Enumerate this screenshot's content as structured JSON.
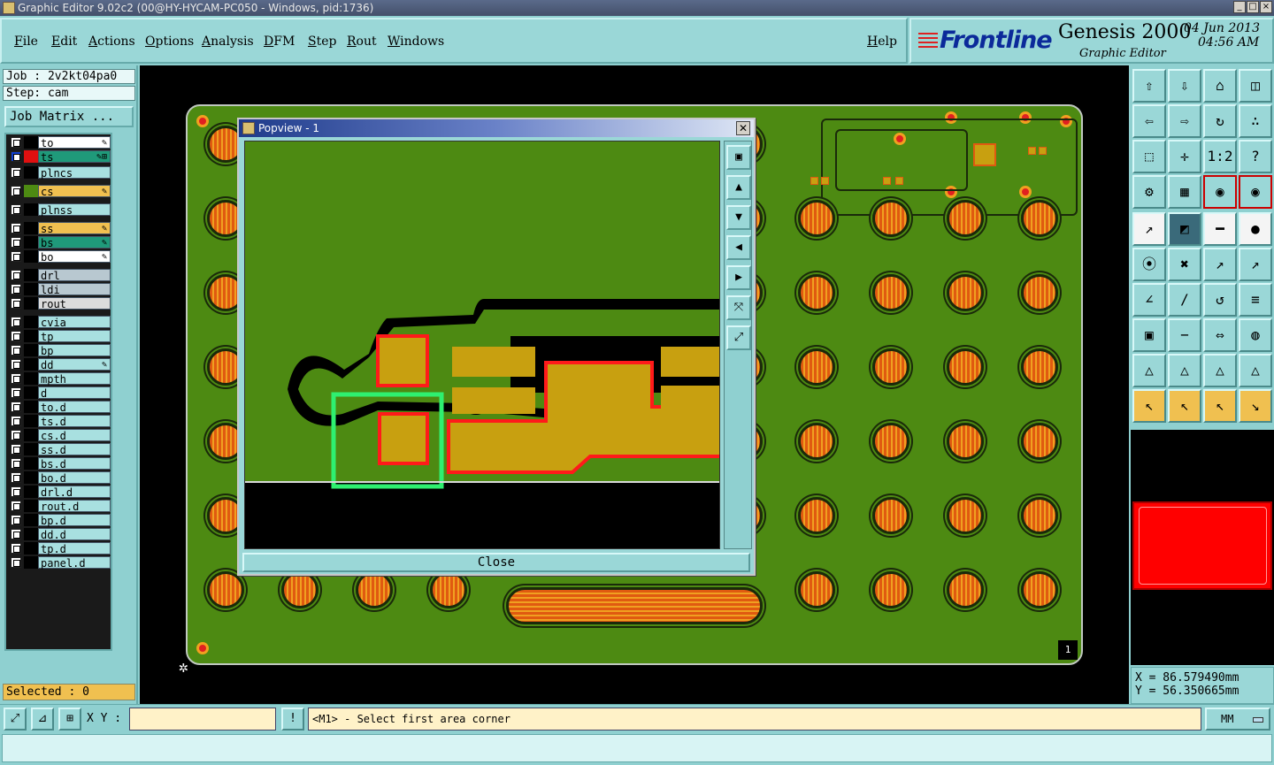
{
  "window": {
    "title": "Graphic Editor 9.02c2 (00@HY-HYCAM-PC050 - Windows, pid:1736)"
  },
  "menu": [
    "File",
    "Edit",
    "Actions",
    "Options",
    "Analysis",
    "DFM",
    "Step",
    "Rout",
    "Windows"
  ],
  "help_label": "Help",
  "logo": {
    "brand": "Frontline",
    "product": "Genesis 2000",
    "subtitle": "Graphic Editor",
    "date": "04 Jun 2013",
    "time": "04:56 AM"
  },
  "job": {
    "job_label": "Job : 2v2kt04pa0",
    "step_label": "Step: cam",
    "matrix_button": "Job Matrix ..."
  },
  "layers": [
    {
      "name": "to",
      "color": "#ffffff",
      "swatch": "#000000",
      "flag": "✎"
    },
    {
      "name": "ts",
      "color": "#1f9a7a",
      "swatch": "#e01010",
      "flag": "✎⊞",
      "active": true
    },
    {
      "name": "plncs",
      "color": "#a8e0e0",
      "swatch": "#000000",
      "flag": ""
    },
    {
      "name": "cs",
      "color": "#f0c050",
      "swatch": "#4d8a12",
      "flag": "✎"
    },
    {
      "name": "plnss",
      "color": "#a8e0e0",
      "swatch": "#000000",
      "flag": ""
    },
    {
      "name": "ss",
      "color": "#f0c050",
      "swatch": "#000000",
      "flag": "✎"
    },
    {
      "name": "bs",
      "color": "#1f9a7a",
      "swatch": "#000000",
      "flag": "✎"
    },
    {
      "name": "bo",
      "color": "#ffffff",
      "swatch": "#000000",
      "flag": "✎"
    },
    {
      "name": "drl",
      "color": "#b8c8d0",
      "swatch": "#000000",
      "flag": ""
    },
    {
      "name": "ldi",
      "color": "#b8c8d0",
      "swatch": "#000000",
      "flag": ""
    },
    {
      "name": "rout",
      "color": "#dcdcdc",
      "swatch": "#000000",
      "flag": ""
    },
    {
      "name": "cvia",
      "color": "#a8e0e0",
      "swatch": "#000000",
      "flag": ""
    },
    {
      "name": "tp",
      "color": "#a8e0e0",
      "swatch": "#000000",
      "flag": ""
    },
    {
      "name": "bp",
      "color": "#a8e0e0",
      "swatch": "#000000",
      "flag": ""
    },
    {
      "name": "dd",
      "color": "#a8e0e0",
      "swatch": "#000000",
      "flag": "✎"
    },
    {
      "name": "mpth",
      "color": "#a8e0e0",
      "swatch": "#000000",
      "flag": ""
    },
    {
      "name": "d",
      "color": "#a8e0e0",
      "swatch": "#000000",
      "flag": ""
    },
    {
      "name": "to.d",
      "color": "#a8e0e0",
      "swatch": "#000000",
      "flag": ""
    },
    {
      "name": "ts.d",
      "color": "#a8e0e0",
      "swatch": "#000000",
      "flag": ""
    },
    {
      "name": "cs.d",
      "color": "#a8e0e0",
      "swatch": "#000000",
      "flag": ""
    },
    {
      "name": "ss.d",
      "color": "#a8e0e0",
      "swatch": "#000000",
      "flag": ""
    },
    {
      "name": "bs.d",
      "color": "#a8e0e0",
      "swatch": "#000000",
      "flag": ""
    },
    {
      "name": "bo.d",
      "color": "#a8e0e0",
      "swatch": "#000000",
      "flag": ""
    },
    {
      "name": "drl.d",
      "color": "#a8e0e0",
      "swatch": "#000000",
      "flag": ""
    },
    {
      "name": "rout.d",
      "color": "#a8e0e0",
      "swatch": "#000000",
      "flag": ""
    },
    {
      "name": "bp.d",
      "color": "#a8e0e0",
      "swatch": "#000000",
      "flag": ""
    },
    {
      "name": "dd.d",
      "color": "#a8e0e0",
      "swatch": "#000000",
      "flag": ""
    },
    {
      "name": "tp.d",
      "color": "#a8e0e0",
      "swatch": "#000000",
      "flag": ""
    },
    {
      "name": "panel.d",
      "color": "#a8e0e0",
      "swatch": "#000000",
      "flag": ""
    }
  ],
  "selected_label": "Selected : 0",
  "canvas": {
    "page_number": "1"
  },
  "popview": {
    "title": "Popview - 1",
    "close_glyph": "✕",
    "close_button": "Close",
    "tools": [
      "zoom-fit-icon",
      "pan-up-icon",
      "pan-down-icon",
      "pan-left-icon",
      "pan-right-icon",
      "zoom-in-icon",
      "zoom-out-icon"
    ],
    "tool_glyphs": [
      "▣",
      "▲",
      "▼",
      "◀",
      "▶",
      "⤧",
      "⤢"
    ]
  },
  "right_tools": {
    "glyphs": [
      "⇧",
      "⇩",
      "⌂",
      "◫",
      "⇦",
      "⇨",
      "↻",
      "∴",
      "⬚",
      "✛",
      "1:2",
      "?",
      "⚙",
      "▦",
      "◉",
      "◉",
      "↗",
      "◩",
      "━",
      "●",
      "⦿",
      "✖",
      "↗",
      "↗",
      "∠",
      "∕",
      "↺",
      "≡",
      "▣",
      "−",
      "⇔",
      "◍",
      "△",
      "△",
      "△",
      "△",
      "↖",
      "↖",
      "↖",
      "↘"
    ]
  },
  "coords": {
    "x": "X = 86.579490mm",
    "y": "Y = 56.350665mm"
  },
  "bottom": {
    "xy_label": "X Y :",
    "xy_value": "",
    "info_glyph": "!",
    "prompt": "<M1> - Select first area corner",
    "units": "MM"
  }
}
